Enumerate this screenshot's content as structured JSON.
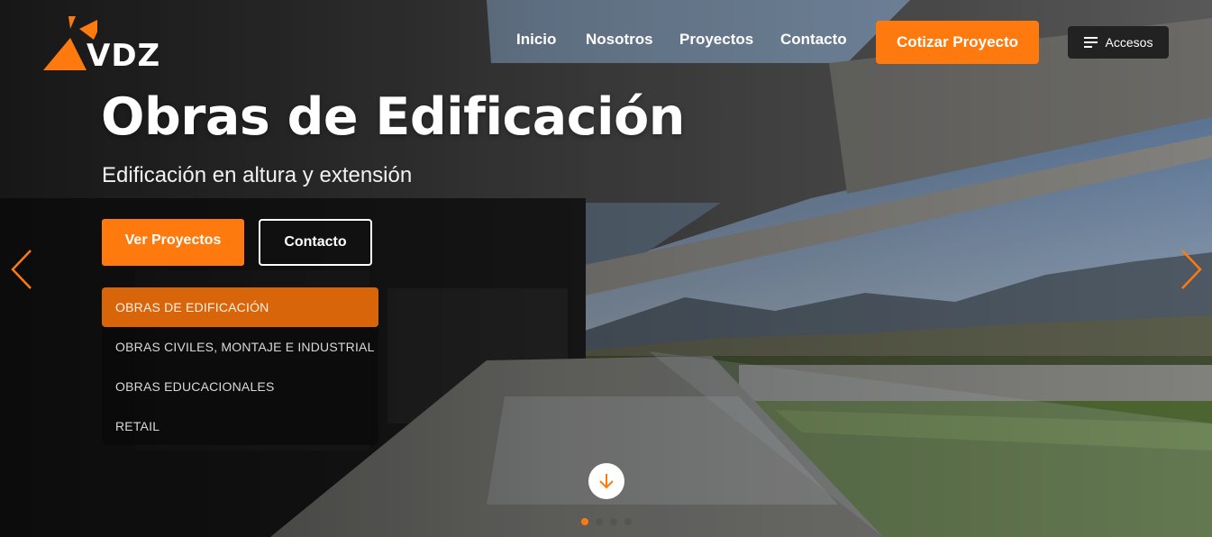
{
  "brand": {
    "name": "VDZ",
    "accent": "#ff7a0e"
  },
  "nav": {
    "items": [
      "Inicio",
      "Nosotros",
      "Proyectos",
      "Contacto"
    ],
    "cta_label": "Cotizar Proyecto",
    "accesos_label": "Accesos"
  },
  "hero": {
    "title": "Obras de Edificación",
    "subtitle": "Edificación en altura y extensión",
    "primary_button": "Ver Proyectos",
    "secondary_button": "Contacto"
  },
  "categories": {
    "items": [
      "OBRAS DE EDIFICACIÓN",
      "OBRAS CIVILES, MONTAJE E INDUSTRIAL",
      "OBRAS EDUCACIONALES",
      "RETAIL"
    ],
    "active_index": 0
  },
  "carousel": {
    "slides": 4,
    "active_slide": 1
  },
  "icons": [
    "logo-triangle-icon",
    "menu-icon",
    "chevron-left-icon",
    "chevron-right-icon",
    "arrow-down-icon"
  ]
}
